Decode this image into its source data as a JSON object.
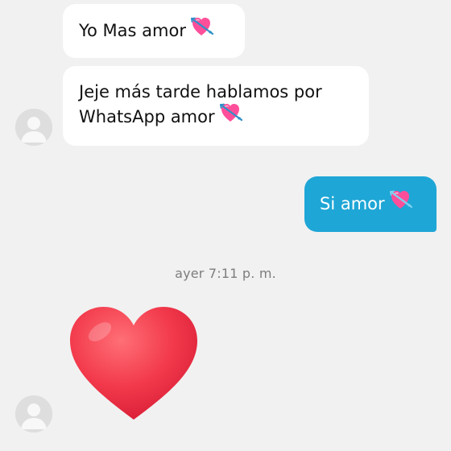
{
  "conversation": {
    "messages": [
      {
        "text": "Yo Mas amor",
        "direction": "incoming",
        "emoji": "heart-with-arrow"
      },
      {
        "text": "Jeje más tarde hablamos por",
        "text_line2": "WhatsApp amor",
        "direction": "incoming",
        "emoji": "heart-with-arrow"
      },
      {
        "text": "Si amor",
        "direction": "outgoing",
        "emoji": "heart-with-arrow"
      }
    ],
    "timestamp": "ayer 7:11 p. m.",
    "sticker": "red-heart"
  },
  "colors": {
    "background": "#f1f1f1",
    "incoming_bubble": "#ffffff",
    "outgoing_bubble": "#1ea6d6",
    "timestamp_text": "#7d7d7d",
    "heart": "#ef3b4e"
  }
}
